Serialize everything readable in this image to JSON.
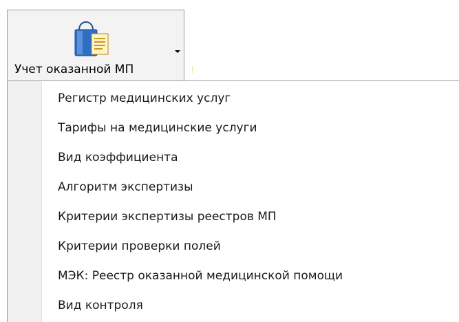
{
  "ribbon_button": {
    "label": "Учет оказанной МП",
    "icon": "shopping-bag-document-icon"
  },
  "menu": {
    "items": [
      {
        "label": "Регистр медицинских услуг"
      },
      {
        "label": "Тарифы на медицинские услуги"
      },
      {
        "label": "Вид коэффициента"
      },
      {
        "label": "Алгоритм экспертизы"
      },
      {
        "label": "Критерии экспертизы реестров МП"
      },
      {
        "label": "Критерии проверки полей"
      },
      {
        "label": "МЭК: Реестр оказанной медицинской помощи"
      },
      {
        "label": "Вид контроля"
      }
    ]
  }
}
